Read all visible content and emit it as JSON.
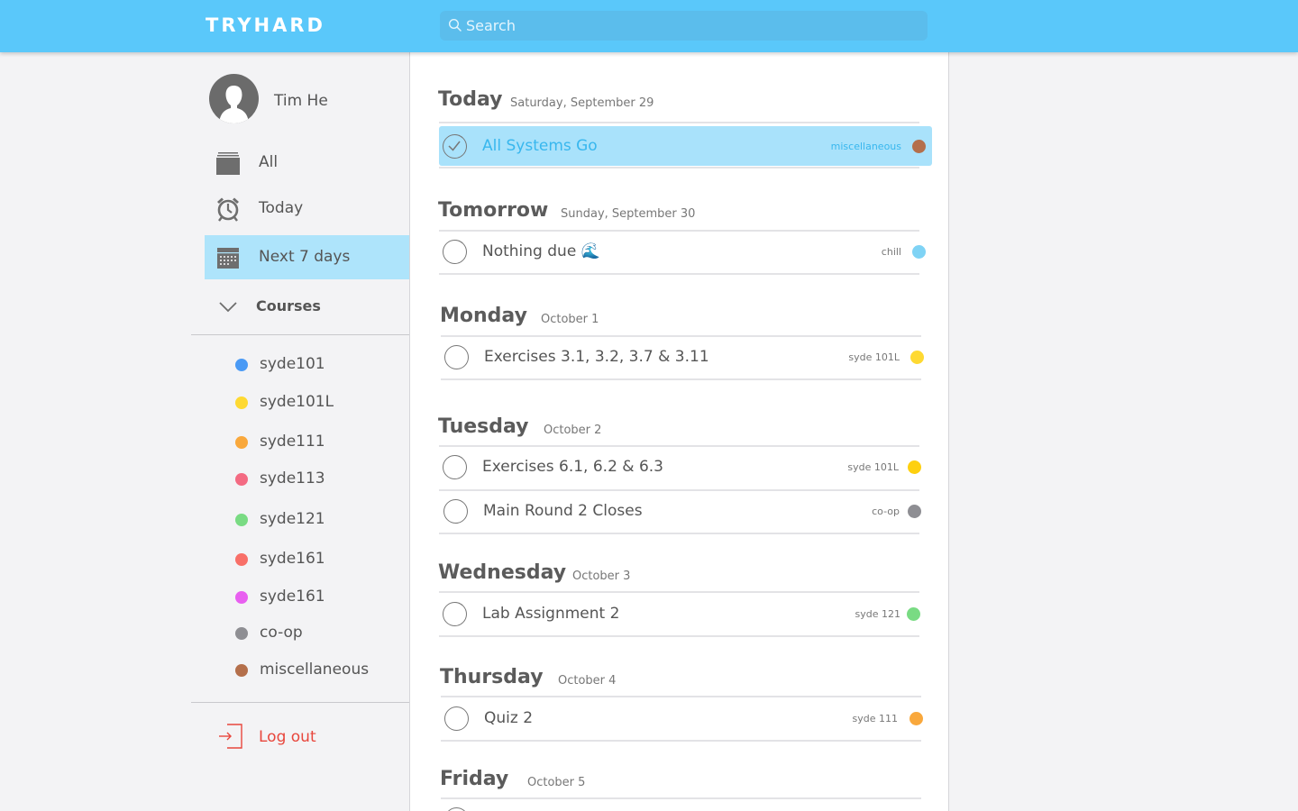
{
  "header": {
    "brand": "TRYHARD",
    "search_placeholder": "Search"
  },
  "profile": {
    "name": "Tim He"
  },
  "nav": {
    "all": "All",
    "today": "Today",
    "next7": "Next 7 days"
  },
  "courses": {
    "heading": "Courses",
    "items": [
      {
        "label": "syde101",
        "color": "#4a9af5"
      },
      {
        "label": "syde101L",
        "color": "#fed932"
      },
      {
        "label": "syde111",
        "color": "#f9a83c"
      },
      {
        "label": "syde113",
        "color": "#f36a82"
      },
      {
        "label": "syde121",
        "color": "#79db83"
      },
      {
        "label": "syde161",
        "color": "#f86f68"
      },
      {
        "label": "syde161",
        "color": "#e85ff0"
      },
      {
        "label": "co-op",
        "color": "#8e8e93"
      },
      {
        "label": "miscellaneous",
        "color": "#b46f4b"
      }
    ]
  },
  "logout": "Log out",
  "days": [
    {
      "day": "Today",
      "date": "Saturday, September 29",
      "tasks": [
        {
          "title": "All Systems Go",
          "tag": "miscellaneous",
          "color": "#b46f4b",
          "done": true
        }
      ]
    },
    {
      "day": "Tomorrow",
      "date": "Sunday, September 30",
      "tasks": [
        {
          "title": "Nothing due 🌊",
          "tag": "chill",
          "color": "#7fd3f5",
          "done": false
        }
      ]
    },
    {
      "day": "Monday",
      "date": "October 1",
      "tasks": [
        {
          "title": "Exercises 3.1, 3.2, 3.7 & 3.11",
          "tag": "syde 101L",
          "color": "#fed932",
          "done": false
        }
      ]
    },
    {
      "day": "Tuesday",
      "date": "October 2",
      "tasks": [
        {
          "title": "Exercises 6.1, 6.2 & 6.3",
          "tag": "syde 101L",
          "color": "#fed00f",
          "done": false
        },
        {
          "title": "Main Round 2 Closes",
          "tag": "co-op",
          "color": "#8e8e93",
          "done": false
        }
      ]
    },
    {
      "day": "Wednesday",
      "date": "October 3",
      "tasks": [
        {
          "title": "Lab Assignment 2",
          "tag": "syde 121",
          "color": "#79db83",
          "done": false
        }
      ]
    },
    {
      "day": "Thursday",
      "date": "October 4",
      "tasks": [
        {
          "title": "Quiz 2",
          "tag": "syde 111",
          "color": "#f9a83c",
          "done": false
        }
      ]
    },
    {
      "day": "Friday",
      "date": "October 5",
      "tasks": []
    }
  ]
}
